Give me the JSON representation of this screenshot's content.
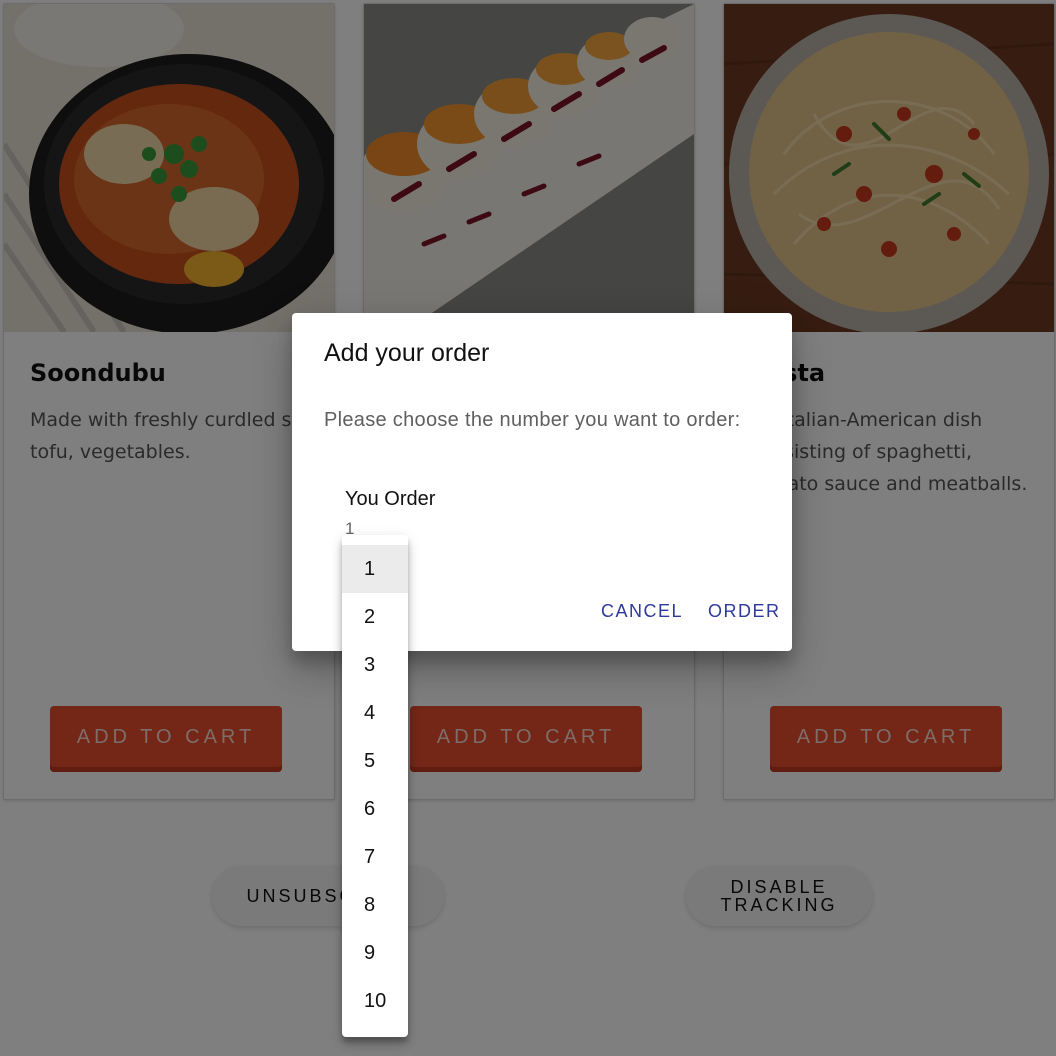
{
  "cards": [
    {
      "title": "Soondubu",
      "description": "Made with freshly curdled soft tofu, vegetables.",
      "button": "ADD TO CART"
    },
    {
      "title": "",
      "description": "",
      "button": "ADD TO CART"
    },
    {
      "title": "Pasta",
      "description": "An Italian-American dish consisting of spaghetti, tomato sauce and meatballs.",
      "button": "ADD TO CART"
    }
  ],
  "footer": {
    "unsubscribe": "UNSUBSCRIBE",
    "disable_tracking": "DISABLE TRACKING"
  },
  "dialog": {
    "title": "Add your order",
    "text": "Please choose the number you want to order:",
    "field_label": "You Order",
    "field_value": "1",
    "cancel": "CANCEL",
    "order": "ORDER"
  },
  "dropdown": {
    "options": [
      "1",
      "2",
      "3",
      "4",
      "5",
      "6",
      "7",
      "8",
      "9",
      "10"
    ],
    "selected": "1"
  },
  "colors": {
    "accent_button": "#e84d2e",
    "dialog_action": "#2e3a9c",
    "scrim": "rgba(0,0,0,0.5)"
  }
}
